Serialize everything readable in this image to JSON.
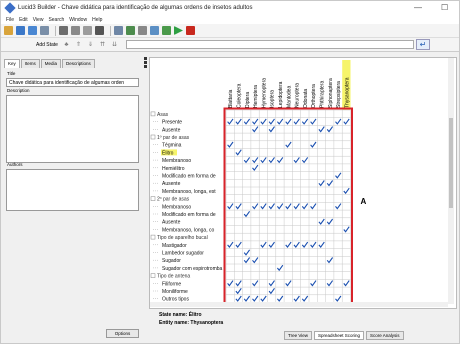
{
  "window": {
    "title": "Lucid3 Builder - Chave didática para identificação de algumas ordens de insetos adultos",
    "minimize": "—",
    "maximize": "☐"
  },
  "menu": [
    "File",
    "Edit",
    "View",
    "Search",
    "Window",
    "Help"
  ],
  "toolbar2": {
    "add_state_label": "Add State"
  },
  "left": {
    "tabs": [
      "Key",
      "Items",
      "Media",
      "Descriptions"
    ],
    "title_label": "Title",
    "title_value": "Chave didática para identificação de algumas orden",
    "description_label": "Description",
    "authors_label": "Authors",
    "options_button": "Options"
  },
  "taxa": [
    "Blattaria",
    "Coleoptera",
    "Diptera",
    "Hemiptera",
    "Hymenoptera",
    "Isoptera",
    "Lepidoptera",
    "Mantodea",
    "Neuroptera",
    "Odonata",
    "Orthoptera",
    "Phthiraptera",
    "Siphonaptera",
    "Strepsiptera",
    "Thysanoptera"
  ],
  "highlighted_taxon_index": 14,
  "rows": [
    {
      "label": "Asas",
      "level": 0,
      "checks": []
    },
    {
      "label": "Presente",
      "level": 1,
      "checks": [
        0,
        1,
        2,
        3,
        4,
        5,
        6,
        7,
        8,
        9,
        10,
        13,
        14
      ]
    },
    {
      "label": "Ausente",
      "level": 1,
      "checks": [
        3,
        5,
        11,
        12
      ]
    },
    {
      "label": "1º par de asas",
      "level": 0,
      "checks": []
    },
    {
      "label": "Tégmina",
      "level": 1,
      "checks": [
        0,
        7,
        10
      ]
    },
    {
      "label": "Élitro",
      "level": 1,
      "checks": [
        1
      ],
      "highlight": true
    },
    {
      "label": "Membranoso",
      "level": 1,
      "checks": [
        2,
        3,
        4,
        5,
        6,
        8,
        9
      ]
    },
    {
      "label": "Hemiélitro",
      "level": 1,
      "checks": [
        3
      ]
    },
    {
      "label": "Modificado em forma de",
      "level": 1,
      "checks": [
        13
      ]
    },
    {
      "label": "Ausente",
      "level": 1,
      "checks": [
        11,
        12
      ]
    },
    {
      "label": "Membranoso, longa, est",
      "level": 1,
      "checks": [
        14
      ]
    },
    {
      "label": "2º par de asas",
      "level": 0,
      "checks": []
    },
    {
      "label": "Membranoso",
      "level": 1,
      "checks": [
        0,
        1,
        3,
        4,
        5,
        6,
        7,
        8,
        9,
        10,
        13
      ]
    },
    {
      "label": "Modificado em forma de",
      "level": 1,
      "checks": [
        2
      ]
    },
    {
      "label": "Ausente",
      "level": 1,
      "checks": [
        11,
        12
      ]
    },
    {
      "label": "Membranoso, longa, co",
      "level": 1,
      "checks": [
        14
      ]
    },
    {
      "label": "Tipo de aparelho bucal",
      "level": 0,
      "checks": []
    },
    {
      "label": "Mastigador",
      "level": 1,
      "checks": [
        0,
        1,
        4,
        5,
        7,
        8,
        9,
        10,
        11
      ]
    },
    {
      "label": "Lambedor sugador",
      "level": 1,
      "checks": [
        2
      ]
    },
    {
      "label": "Sugador",
      "level": 1,
      "checks": [
        2,
        3,
        12
      ]
    },
    {
      "label": "Sugador com espirotromba",
      "level": 1,
      "checks": [
        6
      ]
    },
    {
      "label": "Tipo de antena",
      "level": 0,
      "checks": []
    },
    {
      "label": "Filiforme",
      "level": 1,
      "checks": [
        0,
        1,
        3,
        5,
        7,
        10,
        12,
        14
      ]
    },
    {
      "label": "Moniliforme",
      "level": 1,
      "checks": [
        1,
        5
      ]
    },
    {
      "label": "Outros tipos",
      "level": 1,
      "checks": [
        1,
        2,
        3,
        4,
        6,
        8,
        9,
        13
      ]
    }
  ],
  "annotation_letter": "A",
  "status": {
    "state_name_label": "State name:",
    "state_name_value": "Élitro",
    "entity_name_label": "Entity name:",
    "entity_name_value": "Thysanoptera"
  },
  "bottom_tabs": [
    "Tree View",
    "Spreadsheet Scoring",
    "Score Analysis"
  ],
  "colors": {
    "highlight_yellow": "#f6f46a",
    "check_blue": "#1a4fb0",
    "annotation_red": "#d8232a"
  }
}
